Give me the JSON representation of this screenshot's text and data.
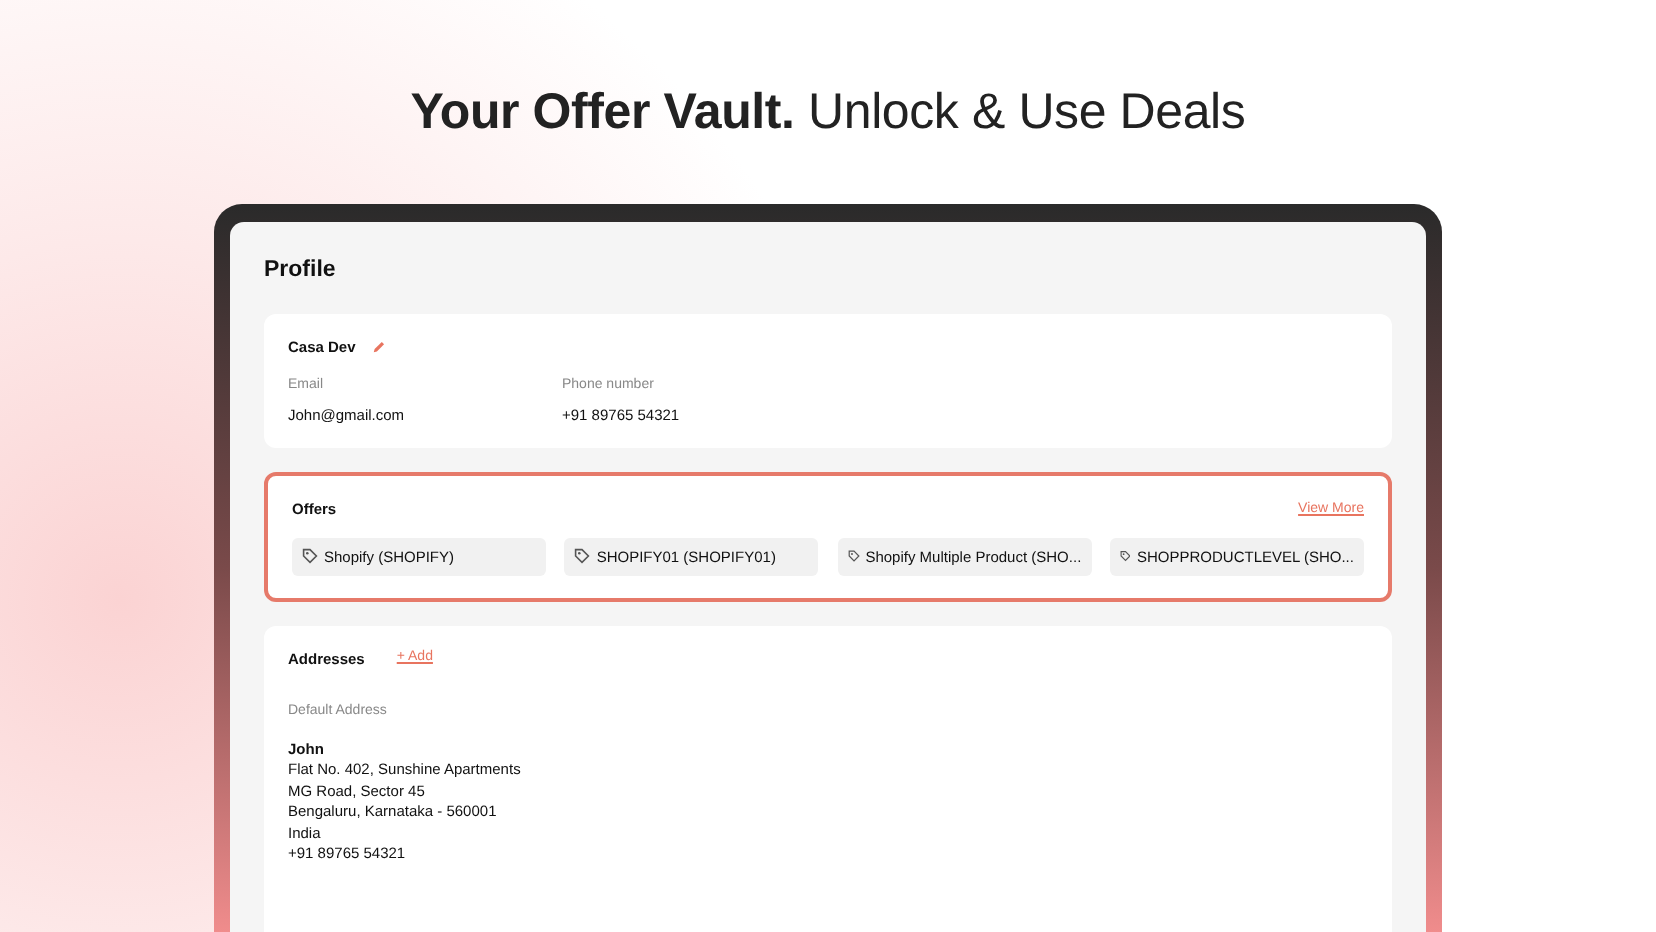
{
  "headline": "**Your Offer Vault.** Unlock & Use Deals",
  "profile": {
    "title": "Profile",
    "name": "Casa Dev",
    "fields": [
      {
        "label": "Email",
        "value": "John@gmail.com"
      },
      {
        "label": "Phone number",
        "value": "+91 89765 54321"
      }
    ]
  },
  "offers": {
    "title": "Offers",
    "link": "View More",
    "items": [
      {
        "label": "Shopify (SHOPIFY)"
      },
      {
        "label": "SHOPIFY01 (SHOPIFY01)"
      },
      {
        "label": "Shopify Multiple Product (SHO..."
      },
      {
        "label": "SHOPPRODUCTLEVEL (SHO..."
      }
    ]
  },
  "addresses": {
    "title": "Addresses",
    "add": "+ Add",
    "default_label": "Default Address",
    "name": "John",
    "lines": [
      "Flat No. 402, Sunshine Apartments",
      "MG Road, Sector 45",
      "Bengaluru, Karnataka - 560001",
      "India",
      "+91 89765 54321"
    ]
  }
}
